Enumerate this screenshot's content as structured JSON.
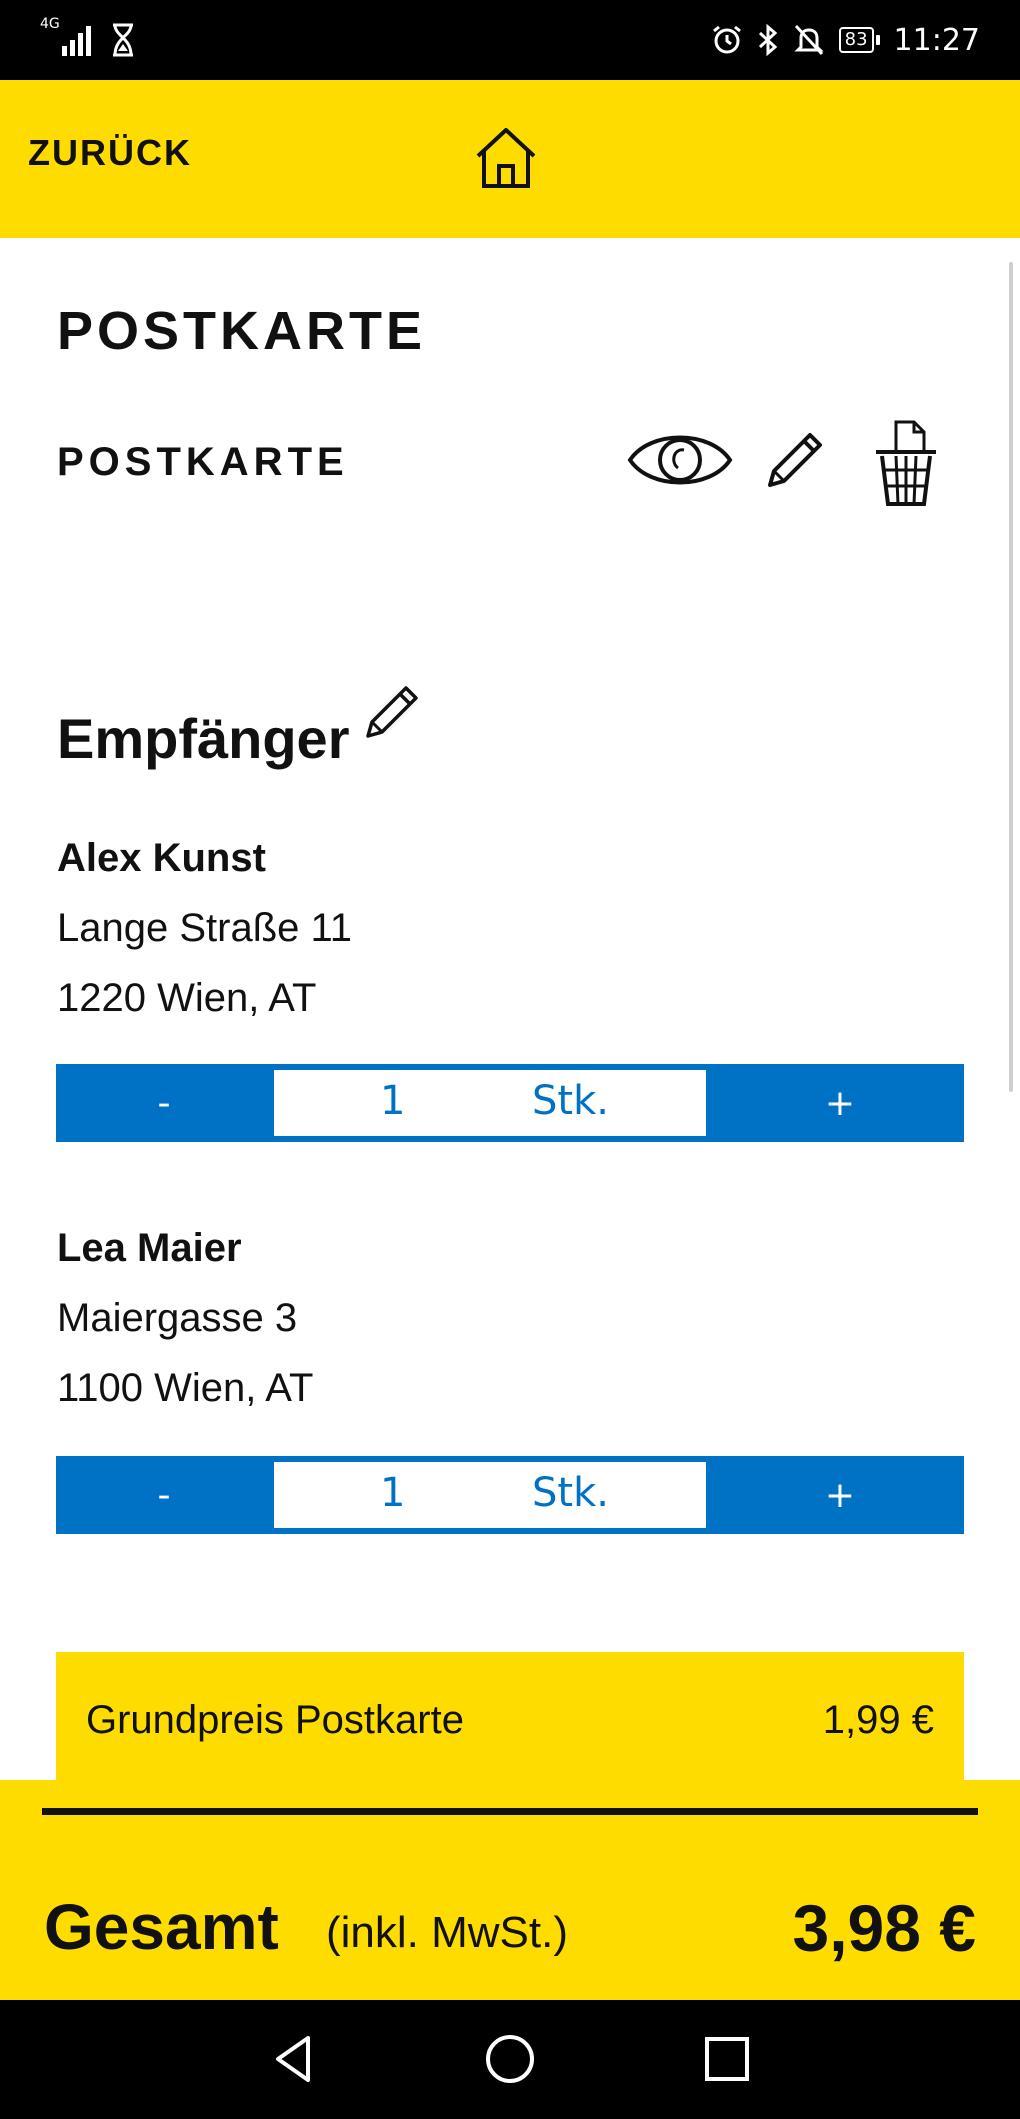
{
  "status_bar": {
    "network": "4G",
    "time": "11:27",
    "battery": "83"
  },
  "header": {
    "back_label": "ZURÜCK",
    "home_icon": "home-icon"
  },
  "page": {
    "title": "POSTKARTE"
  },
  "product": {
    "name": "POSTKARTE",
    "actions": [
      "eye-icon",
      "pencil-icon",
      "trash-icon"
    ]
  },
  "recipients_section": {
    "title": "Empfänger",
    "edit_icon": "pencil-icon"
  },
  "recipients": [
    {
      "name": "Alex Kunst",
      "street": "Lange Straße 11",
      "city": "1220 Wien, AT",
      "quantity": "1",
      "unit": "Stk.",
      "minus_label": "-",
      "plus_label": "+"
    },
    {
      "name": "Lea Maier",
      "street": "Maiergasse 3",
      "city": "1100 Wien, AT",
      "quantity": "1",
      "unit": "Stk.",
      "minus_label": "-",
      "plus_label": "+"
    }
  ],
  "pricing": {
    "base_label": "Grundpreis Postkarte",
    "base_value": "1,99 €",
    "total_label": "Gesamt",
    "total_note": "(inkl. MwSt.)",
    "total_value": "3,98 €"
  },
  "colors": {
    "brand_yellow": "#ffdc00",
    "accent_blue": "#0072c6"
  }
}
